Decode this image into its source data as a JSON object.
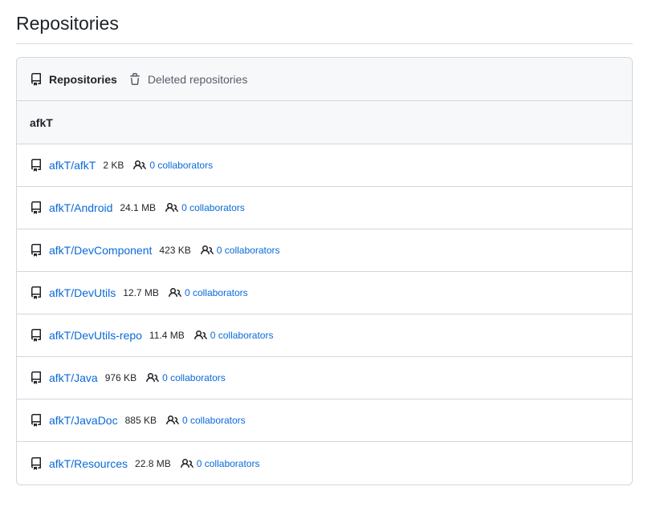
{
  "page": {
    "title": "Repositories"
  },
  "tabs": [
    {
      "label": "Repositories",
      "icon": "repo-icon",
      "active": true
    },
    {
      "label": "Deleted repositories",
      "icon": "trash-icon",
      "active": false
    }
  ],
  "owner": {
    "name": "afkT"
  },
  "repos": [
    {
      "name": "afkT/afkT",
      "size": "2 KB",
      "collaborators": "0 collaborators"
    },
    {
      "name": "afkT/Android",
      "size": "24.1 MB",
      "collaborators": "0 collaborators"
    },
    {
      "name": "afkT/DevComponent",
      "size": "423 KB",
      "collaborators": "0 collaborators"
    },
    {
      "name": "afkT/DevUtils",
      "size": "12.7 MB",
      "collaborators": "0 collaborators"
    },
    {
      "name": "afkT/DevUtils-repo",
      "size": "11.4 MB",
      "collaborators": "0 collaborators"
    },
    {
      "name": "afkT/Java",
      "size": "976 KB",
      "collaborators": "0 collaborators"
    },
    {
      "name": "afkT/JavaDoc",
      "size": "885 KB",
      "collaborators": "0 collaborators"
    },
    {
      "name": "afkT/Resources",
      "size": "22.8 MB",
      "collaborators": "0 collaborators"
    }
  ],
  "colors": {
    "link": "#0969da",
    "border": "#d0d7de",
    "header_bg": "#f6f8fa",
    "text": "#1f2328",
    "muted": "#57606a"
  }
}
